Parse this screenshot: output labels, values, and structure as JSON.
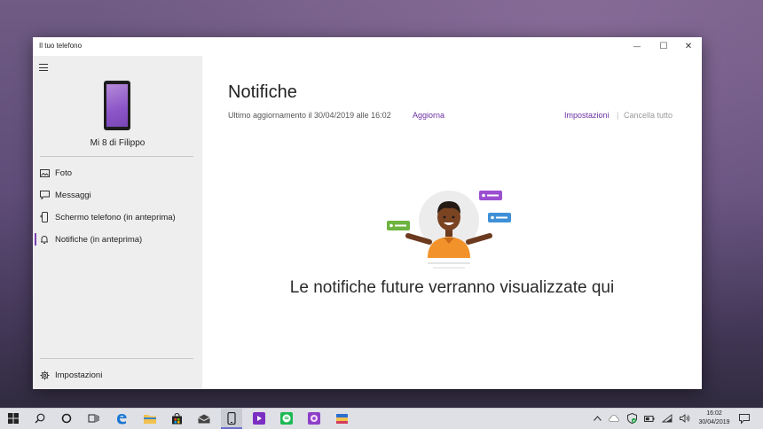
{
  "window": {
    "title": "Il tuo telefono",
    "minimize_glyph": "—",
    "maximize_glyph": "☐",
    "close_glyph": "✕"
  },
  "sidebar": {
    "device_name": "Mi 8 di Filippo",
    "items": [
      {
        "label": "Foto",
        "icon": "photo-icon"
      },
      {
        "label": "Messaggi",
        "icon": "message-icon"
      },
      {
        "label": "Schermo telefono (in anteprima)",
        "icon": "phone-screen-icon"
      },
      {
        "label": "Notifiche (in anteprima)",
        "icon": "bell-icon",
        "active": true
      }
    ],
    "settings_label": "Impostazioni"
  },
  "main": {
    "title": "Notifiche",
    "last_updated": "Ultimo aggiornamento il 30/04/2019 alle 16:02",
    "refresh_label": "Aggiorna",
    "settings_label": "Impostazioni",
    "separator": "|",
    "clear_all_label": "Cancella tutto",
    "empty_message": "Le notifiche future verranno visualizzate qui"
  },
  "taskbar": {
    "time": "16:02",
    "date": "30/04/2019",
    "apps": [
      "start-icon",
      "search-icon",
      "cortana-icon",
      "task-view-icon",
      "edge-icon",
      "file-explorer-icon",
      "store-icon",
      "mail-icon",
      "your-phone-icon",
      "media-icon",
      "spotify-icon",
      "app-icon",
      "winrar-icon"
    ]
  },
  "colors": {
    "accent": "#6b2fa3",
    "sidebar_bg": "#eeeeee",
    "taskbar_bg": "#dfe0e5"
  }
}
